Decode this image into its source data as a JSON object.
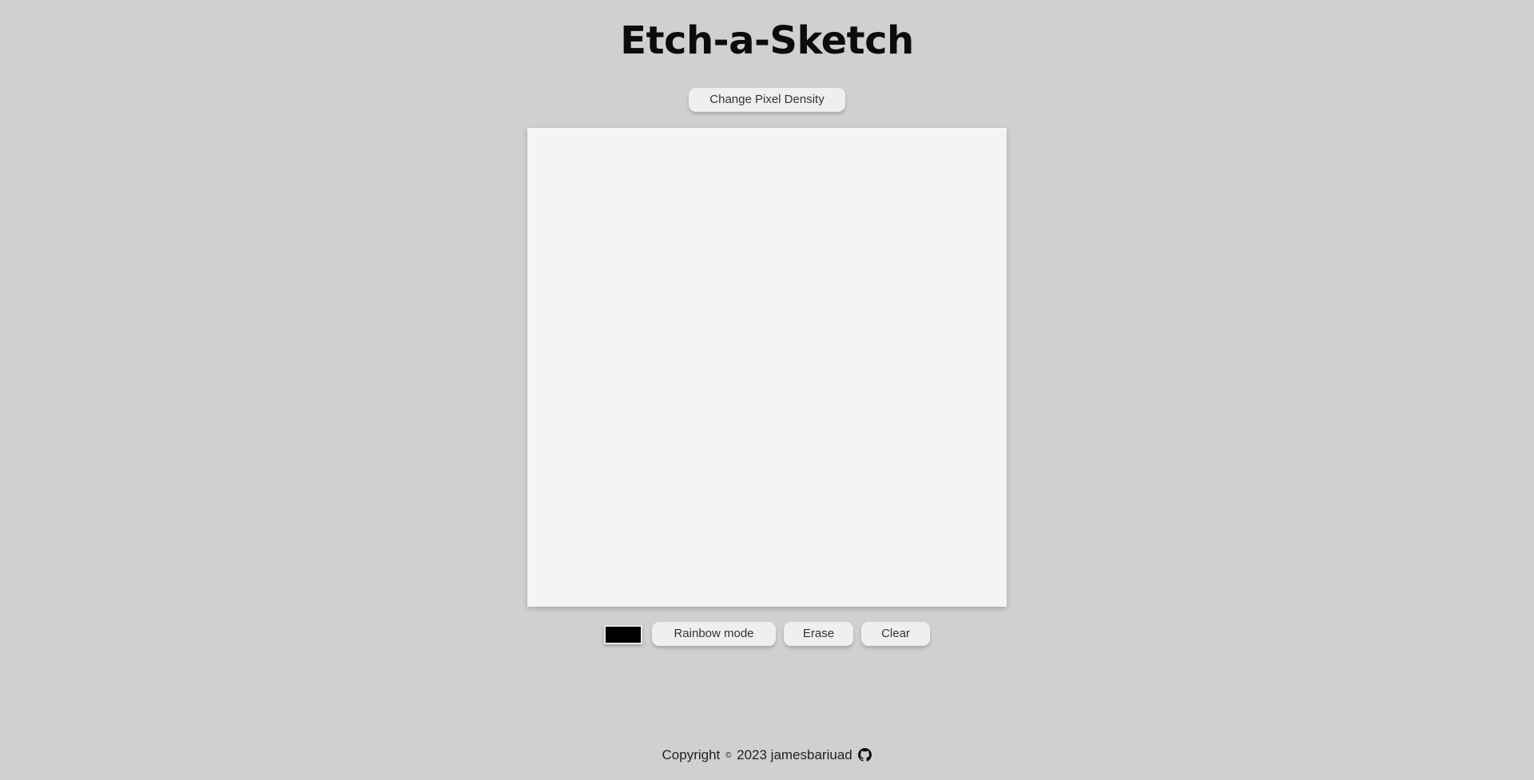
{
  "header": {
    "title": "Etch-a-Sketch"
  },
  "toolbar": {
    "density_label": "Change Pixel Density"
  },
  "controls": {
    "color_value": "#000000",
    "rainbow_label": "Rainbow mode",
    "erase_label": "Erase",
    "clear_label": "Clear"
  },
  "footer": {
    "copyright_label": "Copyright",
    "copyright_symbol": "©",
    "year_author": "2023 jamesbariuad",
    "link_icon": "github-icon"
  },
  "colors": {
    "background": "#d0d0d0",
    "canvas": "#f4f4f4",
    "button": "#efefef",
    "pen": "#000000"
  }
}
